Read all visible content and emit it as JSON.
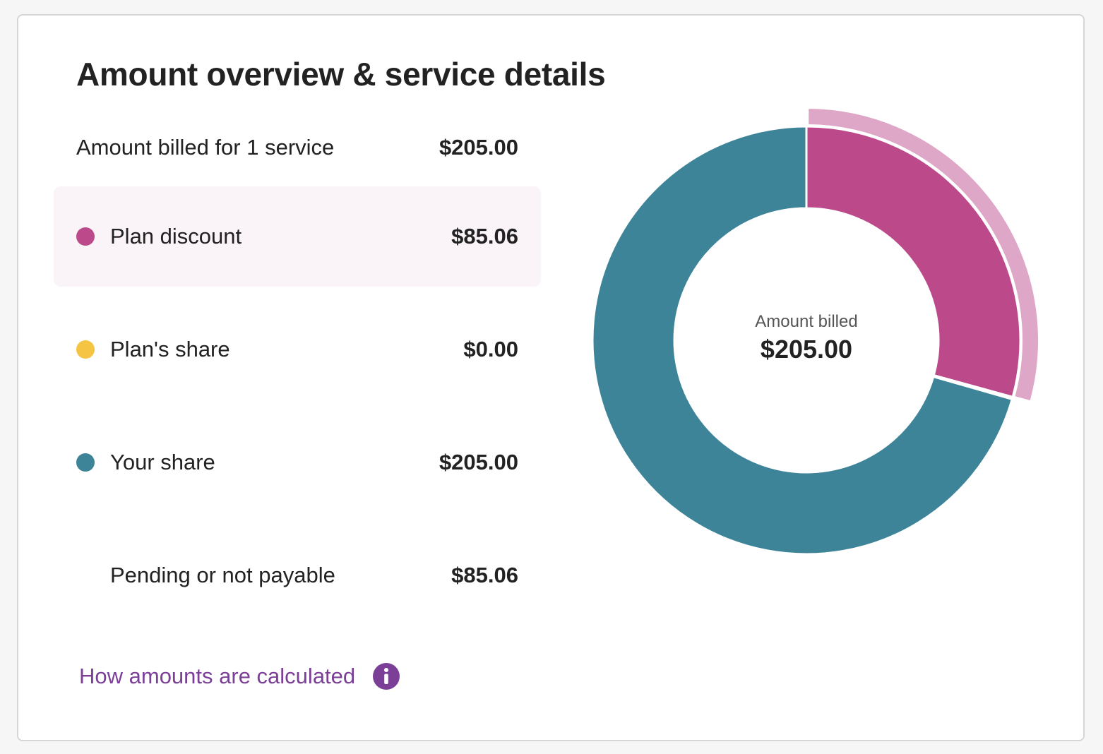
{
  "card": {
    "title": "Amount overview & service details",
    "amount_billed": {
      "label": "Amount billed for 1 service",
      "value": "$205.00"
    },
    "rows": [
      {
        "label": "Plan discount",
        "value": "$85.06",
        "color": "#bc4a8b",
        "highlighted": true
      },
      {
        "label": "Plan's share",
        "value": "$0.00",
        "color": "#f5c443",
        "highlighted": false
      },
      {
        "label": "Your share",
        "value": "$205.00",
        "color": "#3d8499",
        "highlighted": false
      },
      {
        "label": "Pending or not payable",
        "value": "$85.06",
        "color": null,
        "highlighted": false
      }
    ],
    "link": {
      "label": "How amounts are calculated",
      "icon": "info-icon",
      "color": "#7b3f98"
    }
  },
  "chart_data": {
    "type": "pie",
    "center_label": "Amount billed",
    "center_value": "$205.00",
    "total": 290.06,
    "slices": [
      {
        "label": "Plan discount",
        "value": 85.06,
        "color": "#bc4a8b"
      },
      {
        "label": "Plan's share",
        "value": 0.0,
        "color": "#f5c443"
      },
      {
        "label": "Your share",
        "value": 205.0,
        "color": "#3d8499"
      }
    ],
    "highlighted_slice": "Plan discount",
    "highlight_color": "#dfa7c7"
  }
}
